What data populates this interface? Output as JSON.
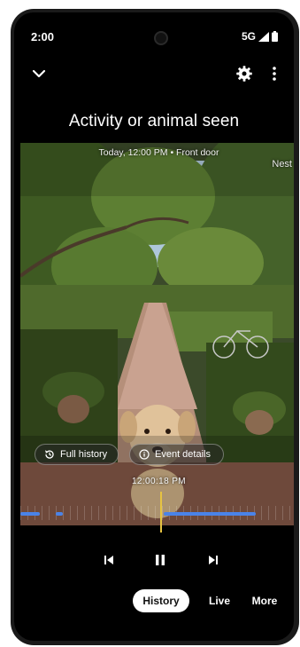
{
  "status_bar": {
    "time": "2:00",
    "network": "5G"
  },
  "top_bar": {
    "back_icon": "chevron-down-icon",
    "settings_icon": "gear-icon",
    "menu_icon": "more-vert-icon"
  },
  "event": {
    "title": "Activity or animal seen",
    "subtitle": "Today, 12:00 PM • Front door",
    "brand": "Nest",
    "timestamp": "12:00:18 PM"
  },
  "chips": {
    "full_history": "Full history",
    "event_details": "Event details"
  },
  "playback": {
    "state": "playing",
    "prev_icon": "skip-previous-icon",
    "pause_icon": "pause-icon",
    "next_icon": "skip-next-icon"
  },
  "tabs": [
    {
      "label": "History",
      "selected": true
    },
    {
      "label": "Live",
      "selected": false
    },
    {
      "label": "More",
      "selected": false
    }
  ],
  "colors": {
    "timeline_event": "#4a83e8",
    "playhead": "#e6c341"
  }
}
